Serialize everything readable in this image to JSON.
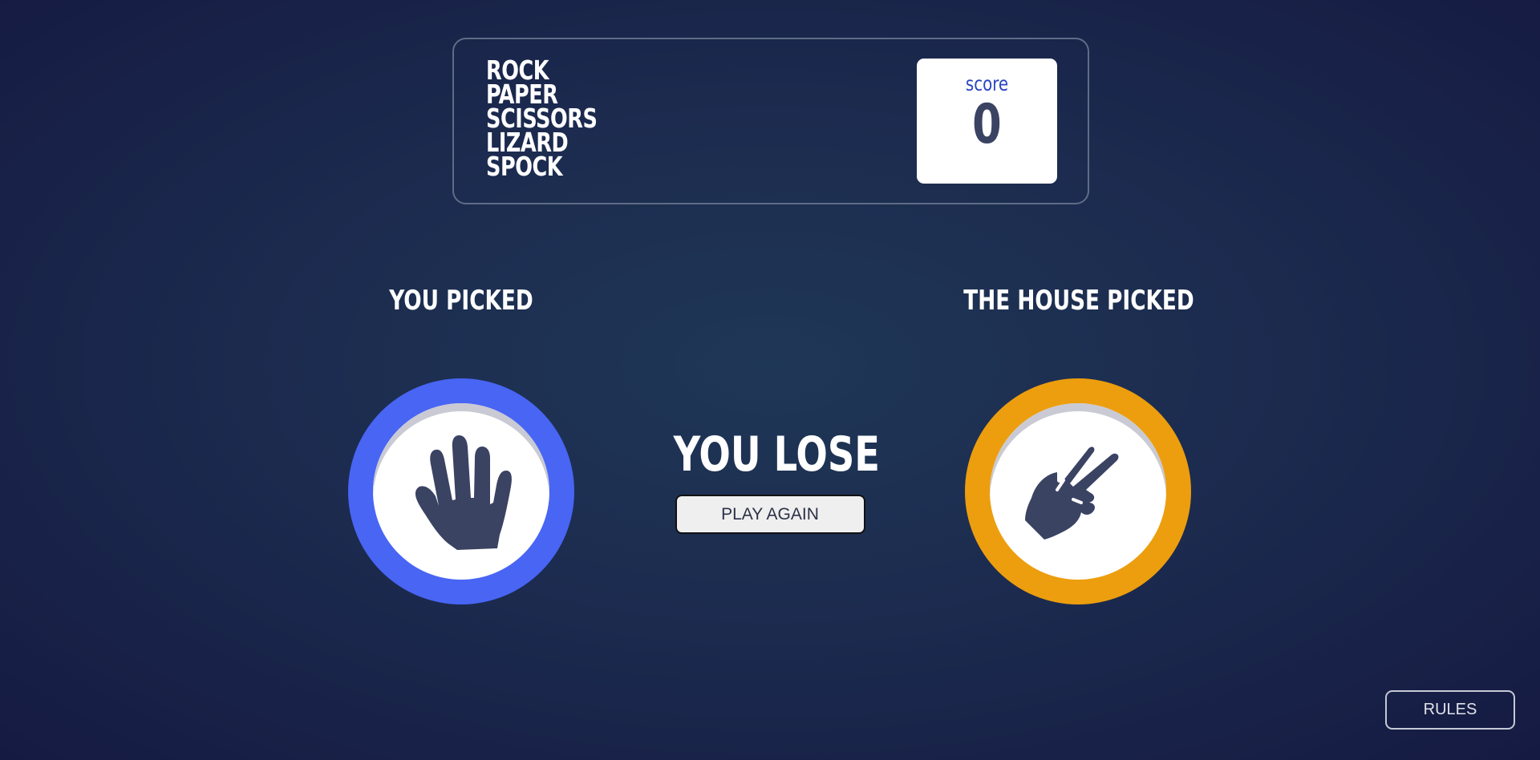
{
  "header": {
    "title_lines": [
      "ROCK",
      "PAPER",
      "SCISSORS",
      "LIZARD",
      "SPOCK"
    ],
    "score_label": "score",
    "score_value": "0"
  },
  "game": {
    "player_label": "YOU PICKED",
    "house_label": "THE HOUSE PICKED",
    "player_pick": {
      "icon": "paper-hand-icon",
      "ring_color": "#4865f4"
    },
    "house_pick": {
      "icon": "scissors-hand-icon",
      "ring_color": "#ec9e0e"
    },
    "result_text": "YOU LOSE",
    "play_again_label": "PLAY AGAIN"
  },
  "footer": {
    "rules_label": "RULES"
  }
}
